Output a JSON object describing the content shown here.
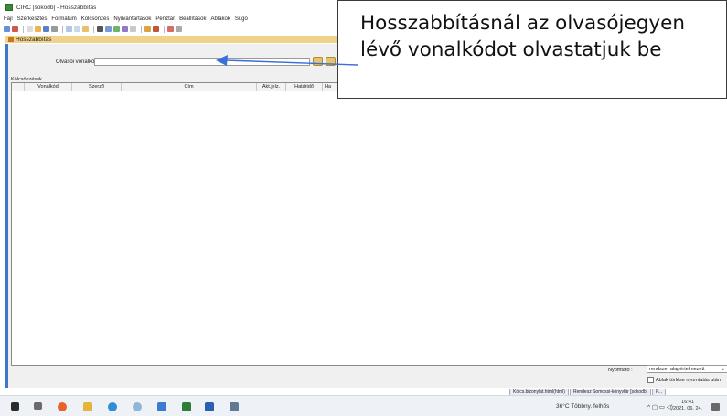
{
  "window": {
    "title": "CIRC [sokodb] - Hosszabbítás"
  },
  "menu": [
    "Fájl",
    "Szerkesztés",
    "Formátum",
    "Kölcsönzés",
    "Nyilvántartások",
    "Pénztár",
    "Beállítások",
    "Ablakok",
    "Súgó"
  ],
  "doc_tab": {
    "label": "Hosszabbítás"
  },
  "form": {
    "barcode_label": "Olvasói vonalkód :",
    "barcode_value": ""
  },
  "loans": {
    "section_label": "Kölcsönzések",
    "columns": [
      "",
      "Vonalkód",
      "Szerző",
      "Cím",
      "Akt.jelz.",
      "Határidő",
      "Ha"
    ]
  },
  "printer": {
    "label": "Nyomtató :",
    "selected": "rendszer alapértelmezett",
    "checkbox_label": "Ablak törlése nyomtatás után",
    "checked": false
  },
  "bottom_tabs": [
    "Kölcs.bizonylat.html(html)",
    "Rendesz Somossi-könyvtár [sokodb]",
    "P..."
  ],
  "taskbar": {
    "weather": "36°C  Többny. felhős",
    "time": "16:41",
    "date": "2021. 06. 24."
  },
  "annotation": {
    "lines": [
      "Hosszabbításnál az olvasójegyen",
      "lévő vonalkódot olvastatjuk be"
    ],
    "arrow_color": "#3a6fd8"
  }
}
